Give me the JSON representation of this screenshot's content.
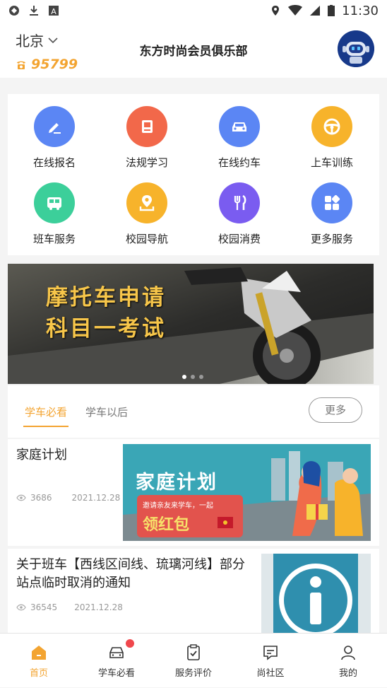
{
  "status_bar": {
    "time": "11:30"
  },
  "header": {
    "city": "北京",
    "phone": "95799",
    "title": "东方时尚会员俱乐部"
  },
  "services": [
    {
      "label": "在线报名",
      "icon": "edit-icon",
      "color": "#5b86f4"
    },
    {
      "label": "法规学习",
      "icon": "book-icon",
      "color": "#f2684a"
    },
    {
      "label": "在线约车",
      "icon": "car-icon",
      "color": "#5b86f4"
    },
    {
      "label": "上车训练",
      "icon": "steering-wheel-icon",
      "color": "#f7b32b"
    },
    {
      "label": "班车服务",
      "icon": "bus-icon",
      "color": "#3ccf9a"
    },
    {
      "label": "校园导航",
      "icon": "map-pin-icon",
      "color": "#f7b32b"
    },
    {
      "label": "校园消费",
      "icon": "cutlery-icon",
      "color": "#7a5cf0"
    },
    {
      "label": "更多服务",
      "icon": "grid-icon",
      "color": "#5b86f4"
    }
  ],
  "banner": {
    "line1": "摩托车申请",
    "line2": "科目一考试"
  },
  "tabs": {
    "items": [
      "学车必看",
      "学车以后"
    ],
    "active_index": 0,
    "more_label": "更多"
  },
  "news": [
    {
      "title": "家庭计划",
      "views": "3686",
      "date": "2021.12.28",
      "image_text": "家庭计划",
      "image_sub": "邀请亲友来学车，一起",
      "image_cta": "领红包"
    },
    {
      "title": "关于班车【西线区间线、琉璃河线】部分站点临时取消的通知",
      "views": "36545",
      "date": "2021.12.28"
    }
  ],
  "tabbar": {
    "items": [
      {
        "label": "首页",
        "icon": "home-icon",
        "active": true
      },
      {
        "label": "学车必看",
        "icon": "car-icon",
        "active": false,
        "badge": true
      },
      {
        "label": "服务评价",
        "icon": "clipboard-check-icon",
        "active": false
      },
      {
        "label": "尚社区",
        "icon": "chat-icon",
        "active": false
      },
      {
        "label": "我的",
        "icon": "user-icon",
        "active": false
      }
    ]
  },
  "colors": {
    "accent": "#f3a431",
    "badge": "#f0474c"
  }
}
